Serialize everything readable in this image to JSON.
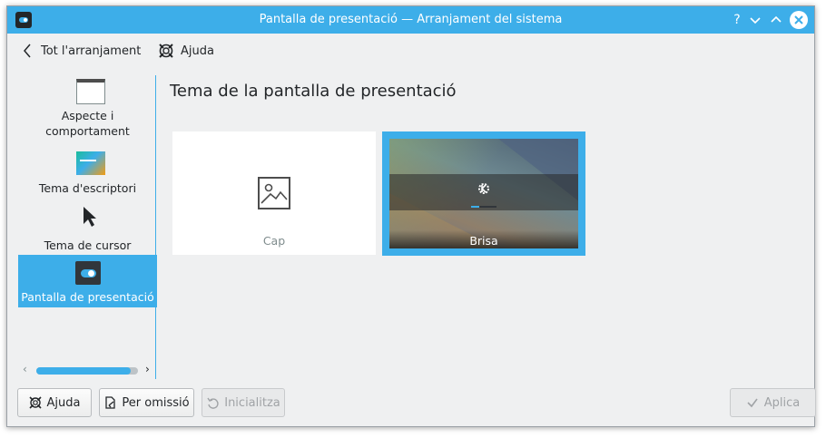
{
  "window": {
    "title": "Pantalla de presentació  — Arranjament del sistema",
    "help_glyph": "?",
    "minimize_glyph": "⌄",
    "maximize_glyph": "⌃",
    "close_glyph": "✕"
  },
  "toolbar": {
    "back_label": "Tot l'arranjament",
    "help_label": "Ajuda"
  },
  "sidebar": {
    "items": [
      {
        "label": "Aspecte i comportament",
        "icon": "window-icon"
      },
      {
        "label": "Tema d'escriptori",
        "icon": "desktop-theme-icon"
      },
      {
        "label": "Tema de cursor",
        "icon": "cursor-icon"
      },
      {
        "label": "Pantalla de presentació",
        "icon": "splash-screen-icon",
        "active": true
      }
    ]
  },
  "main": {
    "heading": "Tema de la pantalla de presentació",
    "themes": [
      {
        "label": "Cap",
        "selected": false
      },
      {
        "label": "Brisa",
        "selected": true
      }
    ]
  },
  "footer": {
    "help_label": "Ajuda",
    "defaults_label": "Per omissió",
    "reset_label": "Inicialitza",
    "apply_label": "Aplica"
  },
  "colors": {
    "accent": "#3daee9",
    "window_bg": "#eff0f1",
    "text": "#232629"
  }
}
